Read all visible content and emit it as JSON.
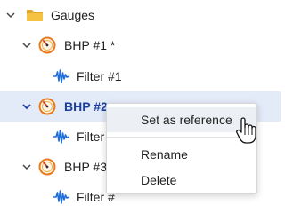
{
  "tree": {
    "root": {
      "label": "Gauges",
      "icon": "folder-icon",
      "expanded": true
    },
    "nodes": [
      {
        "label": "BHP #1 *",
        "icon": "gauge-icon",
        "expanded": true,
        "selected": false,
        "children": [
          {
            "label": "Filter #1",
            "icon": "waveform-icon"
          }
        ]
      },
      {
        "label": "BHP #2",
        "icon": "gauge-icon",
        "expanded": true,
        "selected": true,
        "children": [
          {
            "label": "Filter #",
            "icon": "waveform-icon"
          }
        ]
      },
      {
        "label": "BHP #3",
        "icon": "gauge-icon",
        "expanded": true,
        "selected": false,
        "children": [
          {
            "label": "Filter #",
            "icon": "waveform-icon"
          }
        ]
      }
    ]
  },
  "context_menu": {
    "items": [
      {
        "label": "Set as reference",
        "hovered": true
      },
      {
        "label": "Rename",
        "hovered": false
      },
      {
        "label": "Delete",
        "hovered": false
      }
    ]
  },
  "colors": {
    "selection_bg": "#e3eaf8",
    "selected_text": "#1a3f9e",
    "waveform": "#1e6fd9",
    "folder_back": "#e0a82e",
    "folder_front": "#f5c242",
    "gauge_ring": "#e87a1e"
  }
}
